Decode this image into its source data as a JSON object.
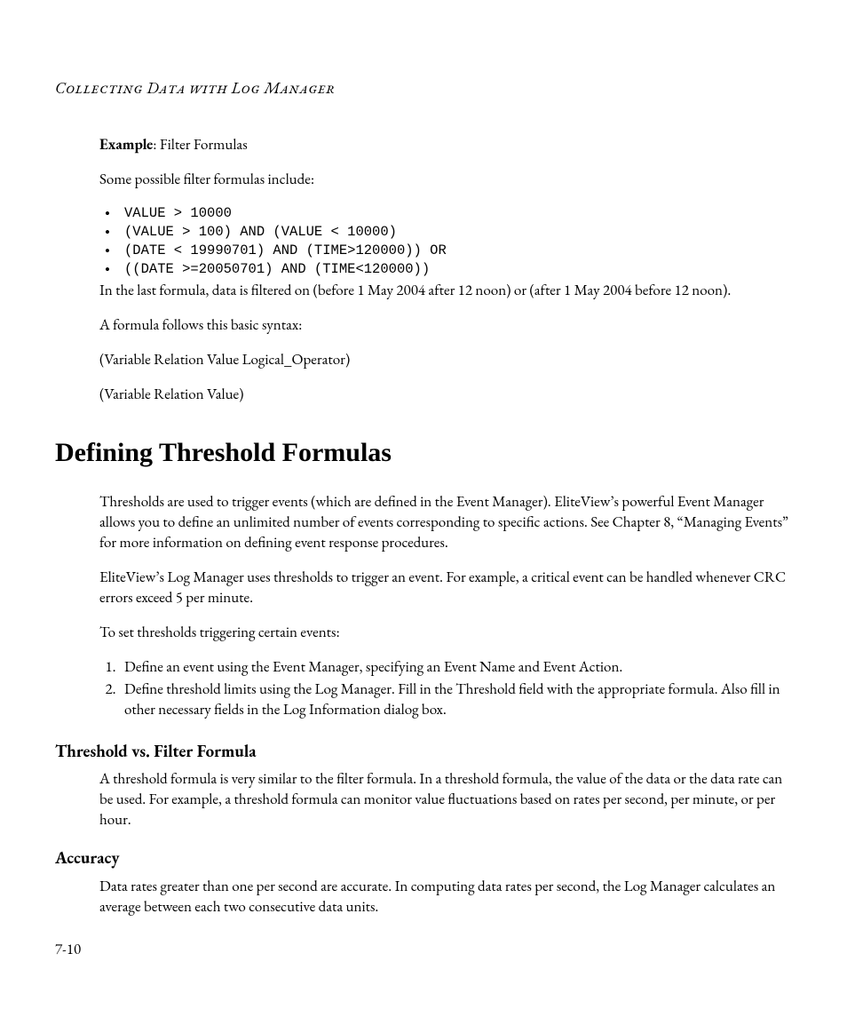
{
  "header": {
    "running_head": "Collecting Data with Log Manager"
  },
  "example": {
    "label_bold": "Example",
    "label_rest": ": Filter Formulas",
    "intro": "Some possible filter formulas include:",
    "bullets": [
      "VALUE > 10000",
      "(VALUE > 100) AND (VALUE < 10000)",
      "(DATE < 19990701) AND (TIME>120000)) OR",
      "((DATE >=20050701) AND (TIME<120000))"
    ],
    "after": "In the last formula, data is filtered on (before 1 May 2004 after 12 noon) or (after 1 May 2004 before 12 noon).",
    "syntax_intro": "A formula follows this basic syntax:",
    "syntax_line1": "(Variable Relation Value Logical_Operator)",
    "syntax_line2": "(Variable Relation Value)"
  },
  "section": {
    "title": "Defining Threshold Formulas",
    "p1": "Thresholds are used to trigger events (which are defined in the Event Manager). EliteView’s powerful Event Manager allows you to define an unlimited number of events corresponding to specific actions. See Chapter 8, “Managing Events” for more information on defining event response procedures.",
    "p2": "EliteView’s Log Manager uses thresholds to trigger an event. For example, a critical event can be handled whenever CRC errors exceed 5 per minute.",
    "p3": "To set thresholds triggering certain events:",
    "steps": [
      "Define an event using the Event Manager, specifying an Event Name and Event Action.",
      "Define threshold limits using the Log Manager. Fill in the Threshold field with the appropriate formula. Also fill in other necessary fields in the Log Information dialog box."
    ],
    "sub1_title": "Threshold vs. Filter Formula",
    "sub1_body": "A threshold formula is very similar to the filter formula. In a threshold formula, the value of the data or the data rate can be used. For example, a threshold formula can monitor value fluctuations based on rates per second, per minute, or per hour.",
    "sub2_title": "Accuracy",
    "sub2_body": "Data rates greater than one per second are accurate. In computing data rates per second, the Log Manager calculates an average between each two consecutive data units."
  },
  "footer": {
    "page": "7-10"
  }
}
